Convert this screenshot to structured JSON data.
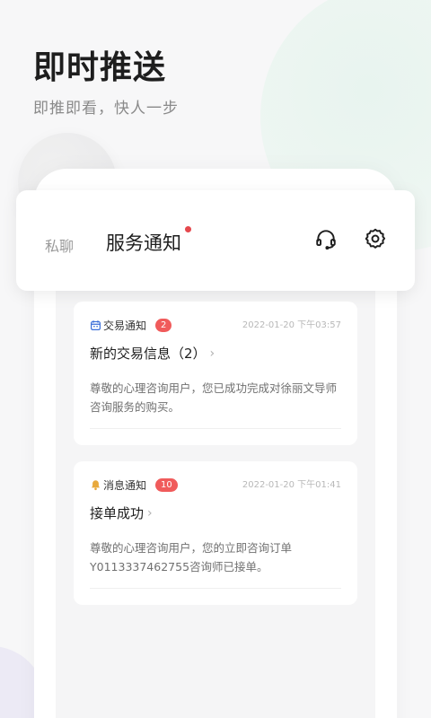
{
  "hero": {
    "title": "即时推送",
    "subtitle": "即推即看，快人一步"
  },
  "header": {
    "tabs": [
      {
        "label": "私聊",
        "active": false
      },
      {
        "label": "服务通知",
        "active": true,
        "has_dot": true
      }
    ],
    "icons": [
      "headset-icon",
      "gear-icon"
    ]
  },
  "notifications": [
    {
      "type_label": "交易通知",
      "type_icon": "calendar-icon",
      "badge": "2",
      "time": "2022-01-20 下午03:57",
      "title": "新的交易信息（2）",
      "body": "尊敬的心理咨询用户，您已成功完成对徐丽文导师咨询服务的购买。"
    },
    {
      "type_label": "消息通知",
      "type_icon": "bell-icon",
      "badge": "10",
      "time": "2022-01-20 下午01:41",
      "title": "接单成功",
      "body": "尊敬的心理咨询用户，您的立即咨询订单Y0113337462755咨询师已接单。"
    }
  ],
  "colors": {
    "accent_red": "#e5484d",
    "badge_red": "#f05b5b",
    "text_dark": "#1e1e1e",
    "text_muted": "#8a8a8a",
    "icon_calendar": "#3b6fd8",
    "icon_bell": "#e8a93c"
  }
}
